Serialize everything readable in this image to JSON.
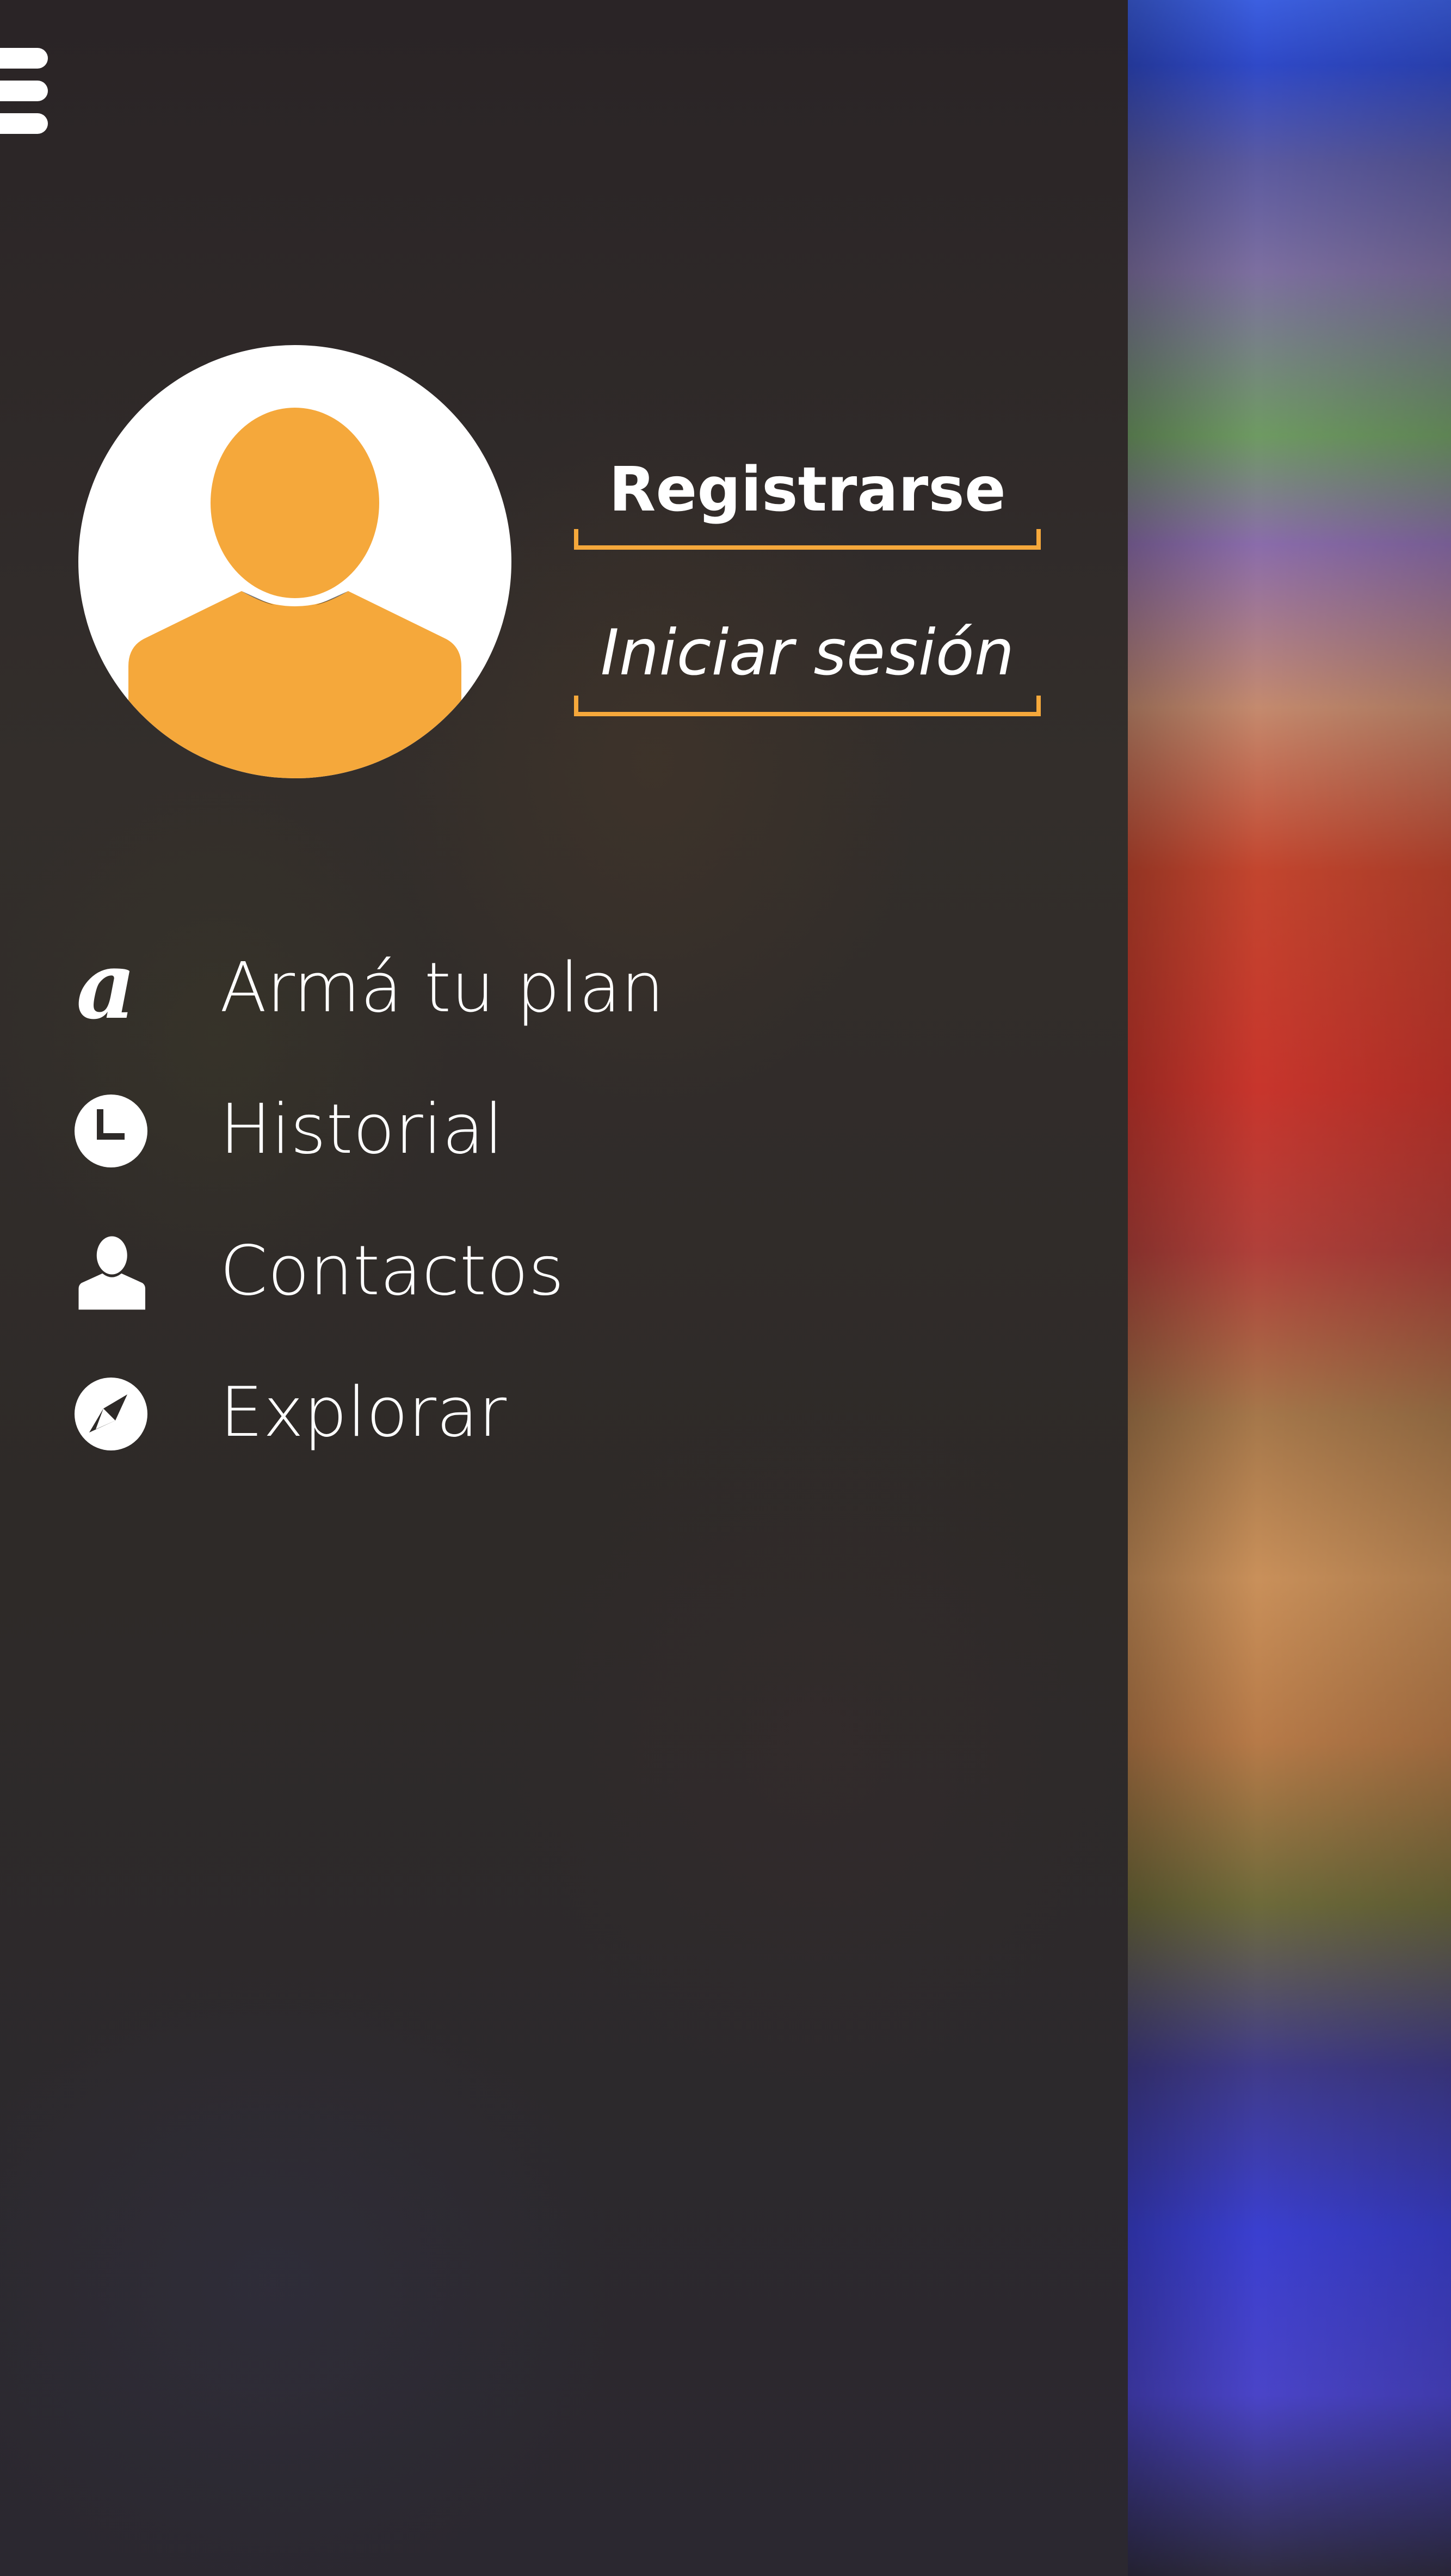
{
  "colors": {
    "accent": "#f5a83b",
    "text": "#ffffff",
    "avatar_bg": "#ffffff"
  },
  "menu_toggle": {
    "icon": "hamburger-icon"
  },
  "profile": {
    "avatar_icon": "user-placeholder-icon",
    "register_label": "Registrarse",
    "login_label": "Iniciar sesión"
  },
  "nav": {
    "items": [
      {
        "label": "Armá tu plan",
        "icon": "letter-a-icon"
      },
      {
        "label": "Historial",
        "icon": "clock-icon"
      },
      {
        "label": "Contactos",
        "icon": "person-icon"
      },
      {
        "label": "Explorar",
        "icon": "compass-icon"
      }
    ]
  }
}
